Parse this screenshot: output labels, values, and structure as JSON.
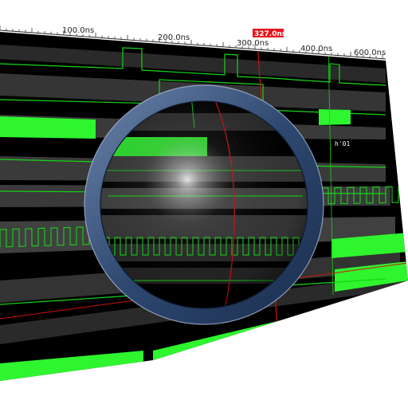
{
  "waveform_viewer": {
    "ruler": {
      "tick_labels": [
        "100.0ns",
        "200.0ns",
        "300.0ns",
        "400.0ns",
        "600.0ns"
      ]
    },
    "cursor": {
      "label": "327.0ns",
      "color": "#e8141a"
    },
    "bus": {
      "value_label": "h'01"
    },
    "colors": {
      "track_background": "#000000",
      "lane_even": "#3a3a3a",
      "lane_odd": "#0d0d0d",
      "signal_green": "#15d615",
      "bus_fill": "#2ef52e",
      "cursor_line": "#d01010",
      "ruler_bg": "#ffffff"
    },
    "icons": {
      "magnifier": "magnifier-lens-icon"
    }
  }
}
